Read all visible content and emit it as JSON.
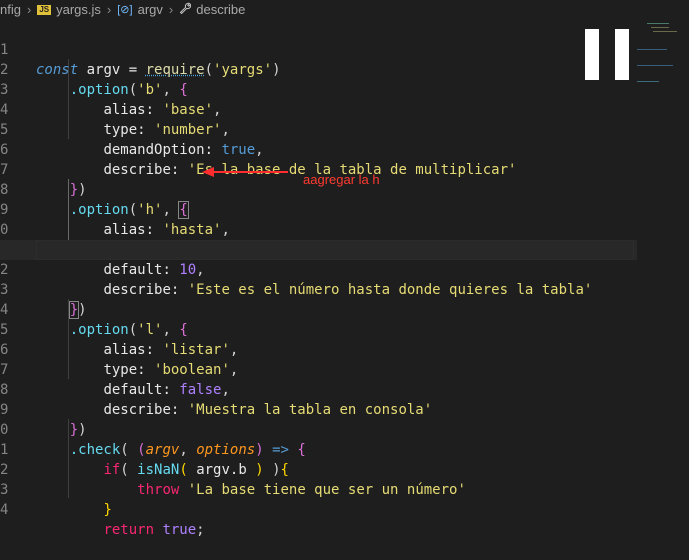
{
  "breadcrumb": {
    "items": [
      "nfig",
      "yargs.js",
      "argv",
      "describe"
    ],
    "js_badge": "JS",
    "var_icon": "[⊘]",
    "wrench_icon": "🔧"
  },
  "editor": {
    "lines": [
      {
        "num": "1"
      },
      {
        "num": "2"
      },
      {
        "num": "3"
      },
      {
        "num": "4"
      },
      {
        "num": "5"
      },
      {
        "num": "6"
      },
      {
        "num": "7"
      },
      {
        "num": "8"
      },
      {
        "num": "9"
      },
      {
        "num": "0"
      },
      {
        "num": "1"
      },
      {
        "num": "2"
      },
      {
        "num": "3"
      },
      {
        "num": "4"
      },
      {
        "num": "5"
      },
      {
        "num": "6"
      },
      {
        "num": "7"
      },
      {
        "num": "8"
      },
      {
        "num": "9"
      },
      {
        "num": "0"
      },
      {
        "num": "1"
      },
      {
        "num": "2"
      },
      {
        "num": "3"
      },
      {
        "num": "4"
      }
    ],
    "tokens": {
      "const": "const",
      "argv": " argv = ",
      "require": "require",
      "lp": "(",
      "yargs": "'yargs'",
      "rp": ")",
      "option": ".option",
      "b": "'b'",
      "comma": ", ",
      "lb": "{",
      "alias_k": "alias: ",
      "base": "'base'",
      "c": ",",
      "type_k": "type: ",
      "number": "'number'",
      "demand_k": "demandOption: ",
      "true_v": "true",
      "describe_k": "describe: ",
      "desc_b": "'Es la base de la tabla de multiplicar'",
      "rb": "}",
      "rp2": ")",
      "h": "'h'",
      "hasta": "'hasta'",
      "default_k": "default: ",
      "ten": "10",
      "desc_h": "'Este es el número hasta donde quieres la tabla'",
      "l": "'l'",
      "listar": "'listar'",
      "boolean": "'boolean'",
      "false_v": "false",
      "desc_l": "'Muestra la tabla en consola'",
      "check": ".check",
      "argv_p": "argv",
      "options_p": "options",
      "arrow": " => ",
      "if_k": "if",
      "isnan": "isNaN",
      "argv_b": " argv.b ",
      "throw_k": "throw",
      "err": "'La base tiene que ser un número'",
      "return_k": "return",
      "true_r": "true"
    }
  },
  "annotation": {
    "text": "aagregar la h",
    "color": "#ff3b30"
  },
  "theme": {
    "background": "#1e1e1e",
    "string_color": "#e6db74",
    "keyword_color": "#569cd6",
    "property_color": "#ffffff"
  }
}
